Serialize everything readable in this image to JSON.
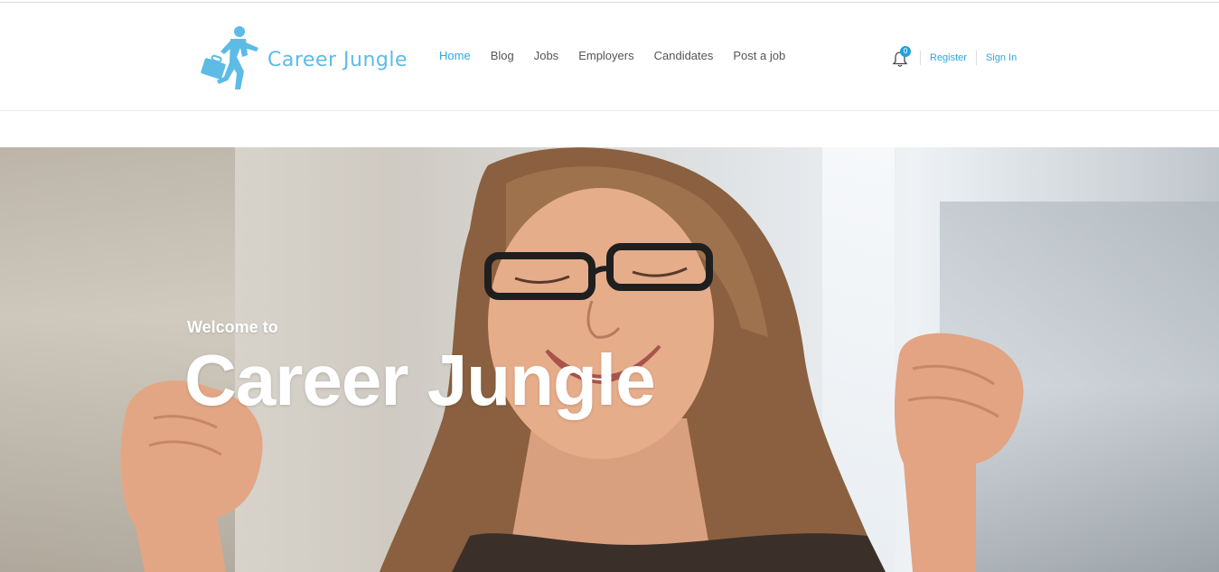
{
  "brand": {
    "name": "Career Jungle",
    "color": "#5dbbe6",
    "icon": "running-businessman-icon"
  },
  "nav": {
    "items": [
      {
        "label": "Home",
        "active": true
      },
      {
        "label": "Blog",
        "active": false
      },
      {
        "label": "Jobs",
        "active": false
      },
      {
        "label": "Employers",
        "active": false
      },
      {
        "label": "Candidates",
        "active": false
      },
      {
        "label": "Post a job",
        "active": false
      }
    ],
    "active_color": "#2fa7da"
  },
  "tools": {
    "notifications": {
      "icon": "bell-icon",
      "count": "0"
    },
    "register_label": "Register",
    "signin_label": "Sign In"
  },
  "hero": {
    "eyebrow": "Welcome to",
    "title": "Career Jungle",
    "image": "excited-woman-with-glasses-raising-fists"
  }
}
